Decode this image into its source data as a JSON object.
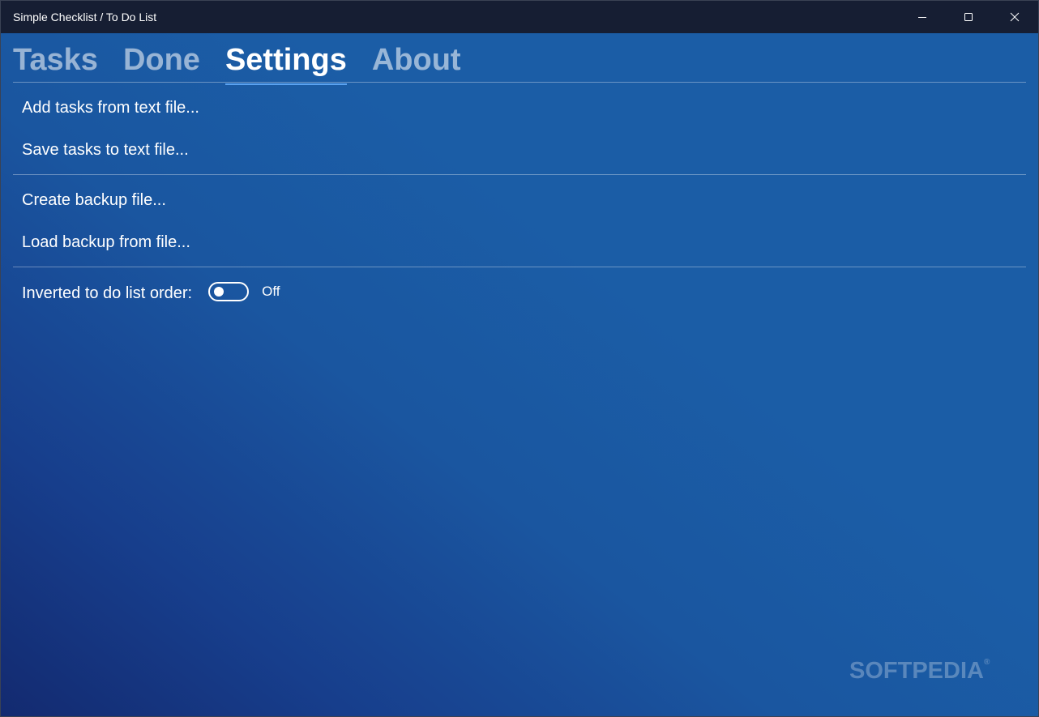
{
  "window": {
    "title": "Simple Checklist / To Do List"
  },
  "tabs": [
    {
      "label": "Tasks",
      "active": false
    },
    {
      "label": "Done",
      "active": false
    },
    {
      "label": "Settings",
      "active": true
    },
    {
      "label": "About",
      "active": false
    }
  ],
  "settings": {
    "add_from_text": "Add tasks from text file...",
    "save_to_text": "Save tasks to text file...",
    "create_backup": "Create backup file...",
    "load_backup": "Load backup from file...",
    "inverted_label": "Inverted to do list order:",
    "inverted_state": "Off"
  },
  "watermark": "SOFTPEDIA",
  "icons": {
    "minimize": "minimize-icon",
    "maximize": "maximize-icon",
    "close": "close-icon"
  },
  "colors": {
    "titlebar": "#161e33",
    "background": "#1b5da6",
    "accent": "#5aa2f0"
  }
}
